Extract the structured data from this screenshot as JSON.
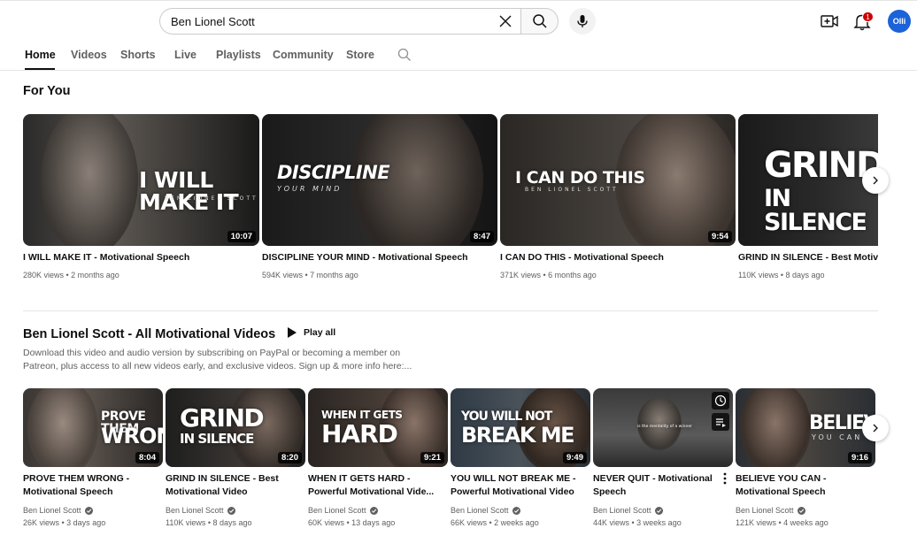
{
  "search": {
    "value": "Ben Lionel Scott",
    "placeholder": "Search"
  },
  "header": {
    "notification_count": "1",
    "avatar_text": "Olli"
  },
  "tabs": [
    {
      "label": "Home",
      "active": true
    },
    {
      "label": "Videos"
    },
    {
      "label": "Shorts"
    },
    {
      "label": "Live"
    },
    {
      "label": "Playlists"
    },
    {
      "label": "Community"
    },
    {
      "label": "Store"
    }
  ],
  "for_you": {
    "title": "For You",
    "videos": [
      {
        "title": "I WILL MAKE IT - Motivational Speech",
        "meta": "280K views • 2 months ago",
        "duration": "10:07",
        "thumb_text": "I WILL MAKE IT",
        "thumb_sub": "BEN LIONEL SCOTT"
      },
      {
        "title": "DISCIPLINE YOUR MIND - Motivational Speech",
        "meta": "594K views • 7 months ago",
        "duration": "8:47",
        "thumb_text": "DISCIPLINE",
        "thumb_sub": "YOUR MIND"
      },
      {
        "title": "I CAN DO THIS - Motivational Speech",
        "meta": "371K views • 6 months ago",
        "duration": "9:54",
        "thumb_text": "I CAN DO THIS",
        "thumb_sub": "BEN LIONEL SCOTT"
      },
      {
        "title": "GRIND IN SILENCE - Best Motivati",
        "meta": "110K views • 8 days ago",
        "duration": "",
        "thumb_text": "GRIND",
        "thumb_sub": "IN SILENCE"
      }
    ]
  },
  "playlist": {
    "title": "Ben Lionel Scott - All Motivational Videos",
    "play_all": "Play all",
    "description_line1": "Download this video and audio version by subscribing on PayPal or becoming a member on",
    "description_line2": "Patreon, plus access to all new videos early, and exclusive videos. Sign up & more info here:...",
    "videos": [
      {
        "title1": "PROVE THEM WRONG -",
        "title2": "Motivational Speech",
        "channel": "Ben Lionel Scott",
        "meta": "26K views • 3 days ago",
        "duration": "8:04",
        "thumb_text": "PROVE THEM",
        "thumb_text2": "WRONG"
      },
      {
        "title1": "GRIND IN SILENCE - Best",
        "title2": "Motivational Video",
        "channel": "Ben Lionel Scott",
        "meta": "110K views • 8 days ago",
        "duration": "8:20",
        "thumb_text": "GRIND",
        "thumb_text2": "IN SILENCE"
      },
      {
        "title1": "WHEN IT GETS HARD -",
        "title2": "Powerful Motivational Vide...",
        "channel": "Ben Lionel Scott",
        "meta": "60K views • 13 days ago",
        "duration": "9:21",
        "thumb_text": "WHEN IT GETS",
        "thumb_text2": "HARD"
      },
      {
        "title1": "YOU WILL NOT BREAK ME -",
        "title2": "Powerful Motivational Video",
        "channel": "Ben Lionel Scott",
        "meta": "66K views • 2 weeks ago",
        "duration": "9:49",
        "thumb_text": "YOU WILL NOT",
        "thumb_text2": "BREAK ME"
      },
      {
        "title1": "NEVER QUIT - Motivational",
        "title2": "Speech",
        "channel": "Ben Lionel Scott",
        "meta": "44K views • 3 weeks ago",
        "duration": "",
        "thumb_text": "is the mentality of a winner",
        "thumb_text2": ""
      },
      {
        "title1": "BELIEVE YOU CAN -",
        "title2": "Motivational Speech",
        "channel": "Ben Lionel Scott",
        "meta": "121K views • 4 weeks ago",
        "duration": "9:16",
        "thumb_text": "BELIEVE",
        "thumb_text2": "YOU CAN"
      }
    ]
  }
}
